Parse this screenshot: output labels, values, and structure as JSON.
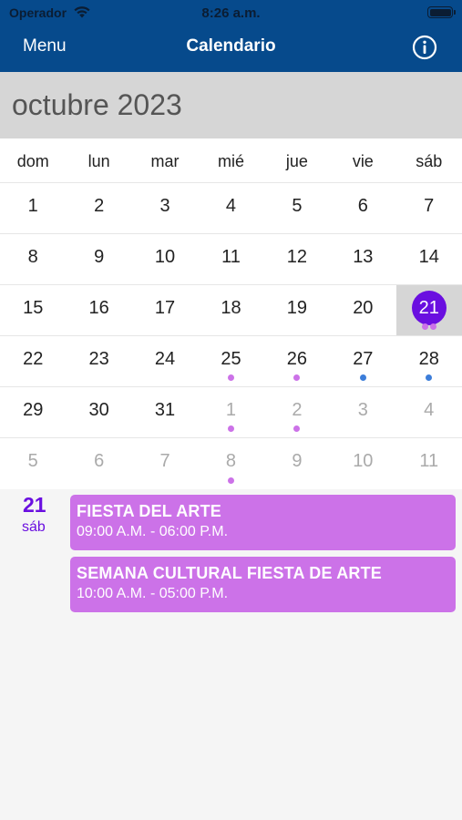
{
  "status_bar": {
    "carrier": "Operador",
    "time": "8:26 a.m."
  },
  "nav": {
    "menu_label": "Menu",
    "title": "Calendario",
    "info_icon": "info-circle-icon"
  },
  "calendar": {
    "month_title": "octubre 2023",
    "weekdays": [
      "dom",
      "lun",
      "mar",
      "mié",
      "jue",
      "vie",
      "sáb"
    ],
    "weeks": [
      [
        {
          "d": "1"
        },
        {
          "d": "2"
        },
        {
          "d": "3"
        },
        {
          "d": "4"
        },
        {
          "d": "5"
        },
        {
          "d": "6"
        },
        {
          "d": "7"
        }
      ],
      [
        {
          "d": "8"
        },
        {
          "d": "9"
        },
        {
          "d": "10"
        },
        {
          "d": "11"
        },
        {
          "d": "12"
        },
        {
          "d": "13"
        },
        {
          "d": "14"
        }
      ],
      [
        {
          "d": "15"
        },
        {
          "d": "16"
        },
        {
          "d": "17"
        },
        {
          "d": "18"
        },
        {
          "d": "19"
        },
        {
          "d": "20"
        },
        {
          "d": "21",
          "selected": true,
          "dots": [
            "#cc72e8",
            "#cc72e8"
          ]
        }
      ],
      [
        {
          "d": "22"
        },
        {
          "d": "23"
        },
        {
          "d": "24"
        },
        {
          "d": "25",
          "dots": [
            "#cc72e8"
          ]
        },
        {
          "d": "26",
          "dots": [
            "#cc72e8"
          ]
        },
        {
          "d": "27",
          "dots": [
            "#3c7dd9"
          ]
        },
        {
          "d": "28",
          "dots": [
            "#3c7dd9"
          ]
        }
      ],
      [
        {
          "d": "29"
        },
        {
          "d": "30"
        },
        {
          "d": "31"
        },
        {
          "d": "1",
          "other": true,
          "dots": [
            "#cc72e8"
          ]
        },
        {
          "d": "2",
          "other": true,
          "dots": [
            "#cc72e8"
          ]
        },
        {
          "d": "3",
          "other": true
        },
        {
          "d": "4",
          "other": true
        }
      ],
      [
        {
          "d": "5",
          "other": true
        },
        {
          "d": "6",
          "other": true
        },
        {
          "d": "7",
          "other": true
        },
        {
          "d": "8",
          "other": true,
          "dots": [
            "#cc72e8"
          ]
        },
        {
          "d": "9",
          "other": true
        },
        {
          "d": "10",
          "other": true
        },
        {
          "d": "11",
          "other": true
        }
      ]
    ]
  },
  "selected_day": {
    "day": "21",
    "weekday": "sáb",
    "events": [
      {
        "title": "FIESTA DEL ARTE",
        "hours": "09:00 A.M. - 06:00 P.M."
      },
      {
        "title": "SEMANA CULTURAL FIESTA DE ARTE",
        "hours": "10:00 A.M. - 05:00 P.M."
      }
    ]
  },
  "colors": {
    "nav_bg": "#064a8c",
    "accent": "#6a0fe0",
    "event_bg": "#cc72e8",
    "dot_blue": "#3c7dd9"
  }
}
